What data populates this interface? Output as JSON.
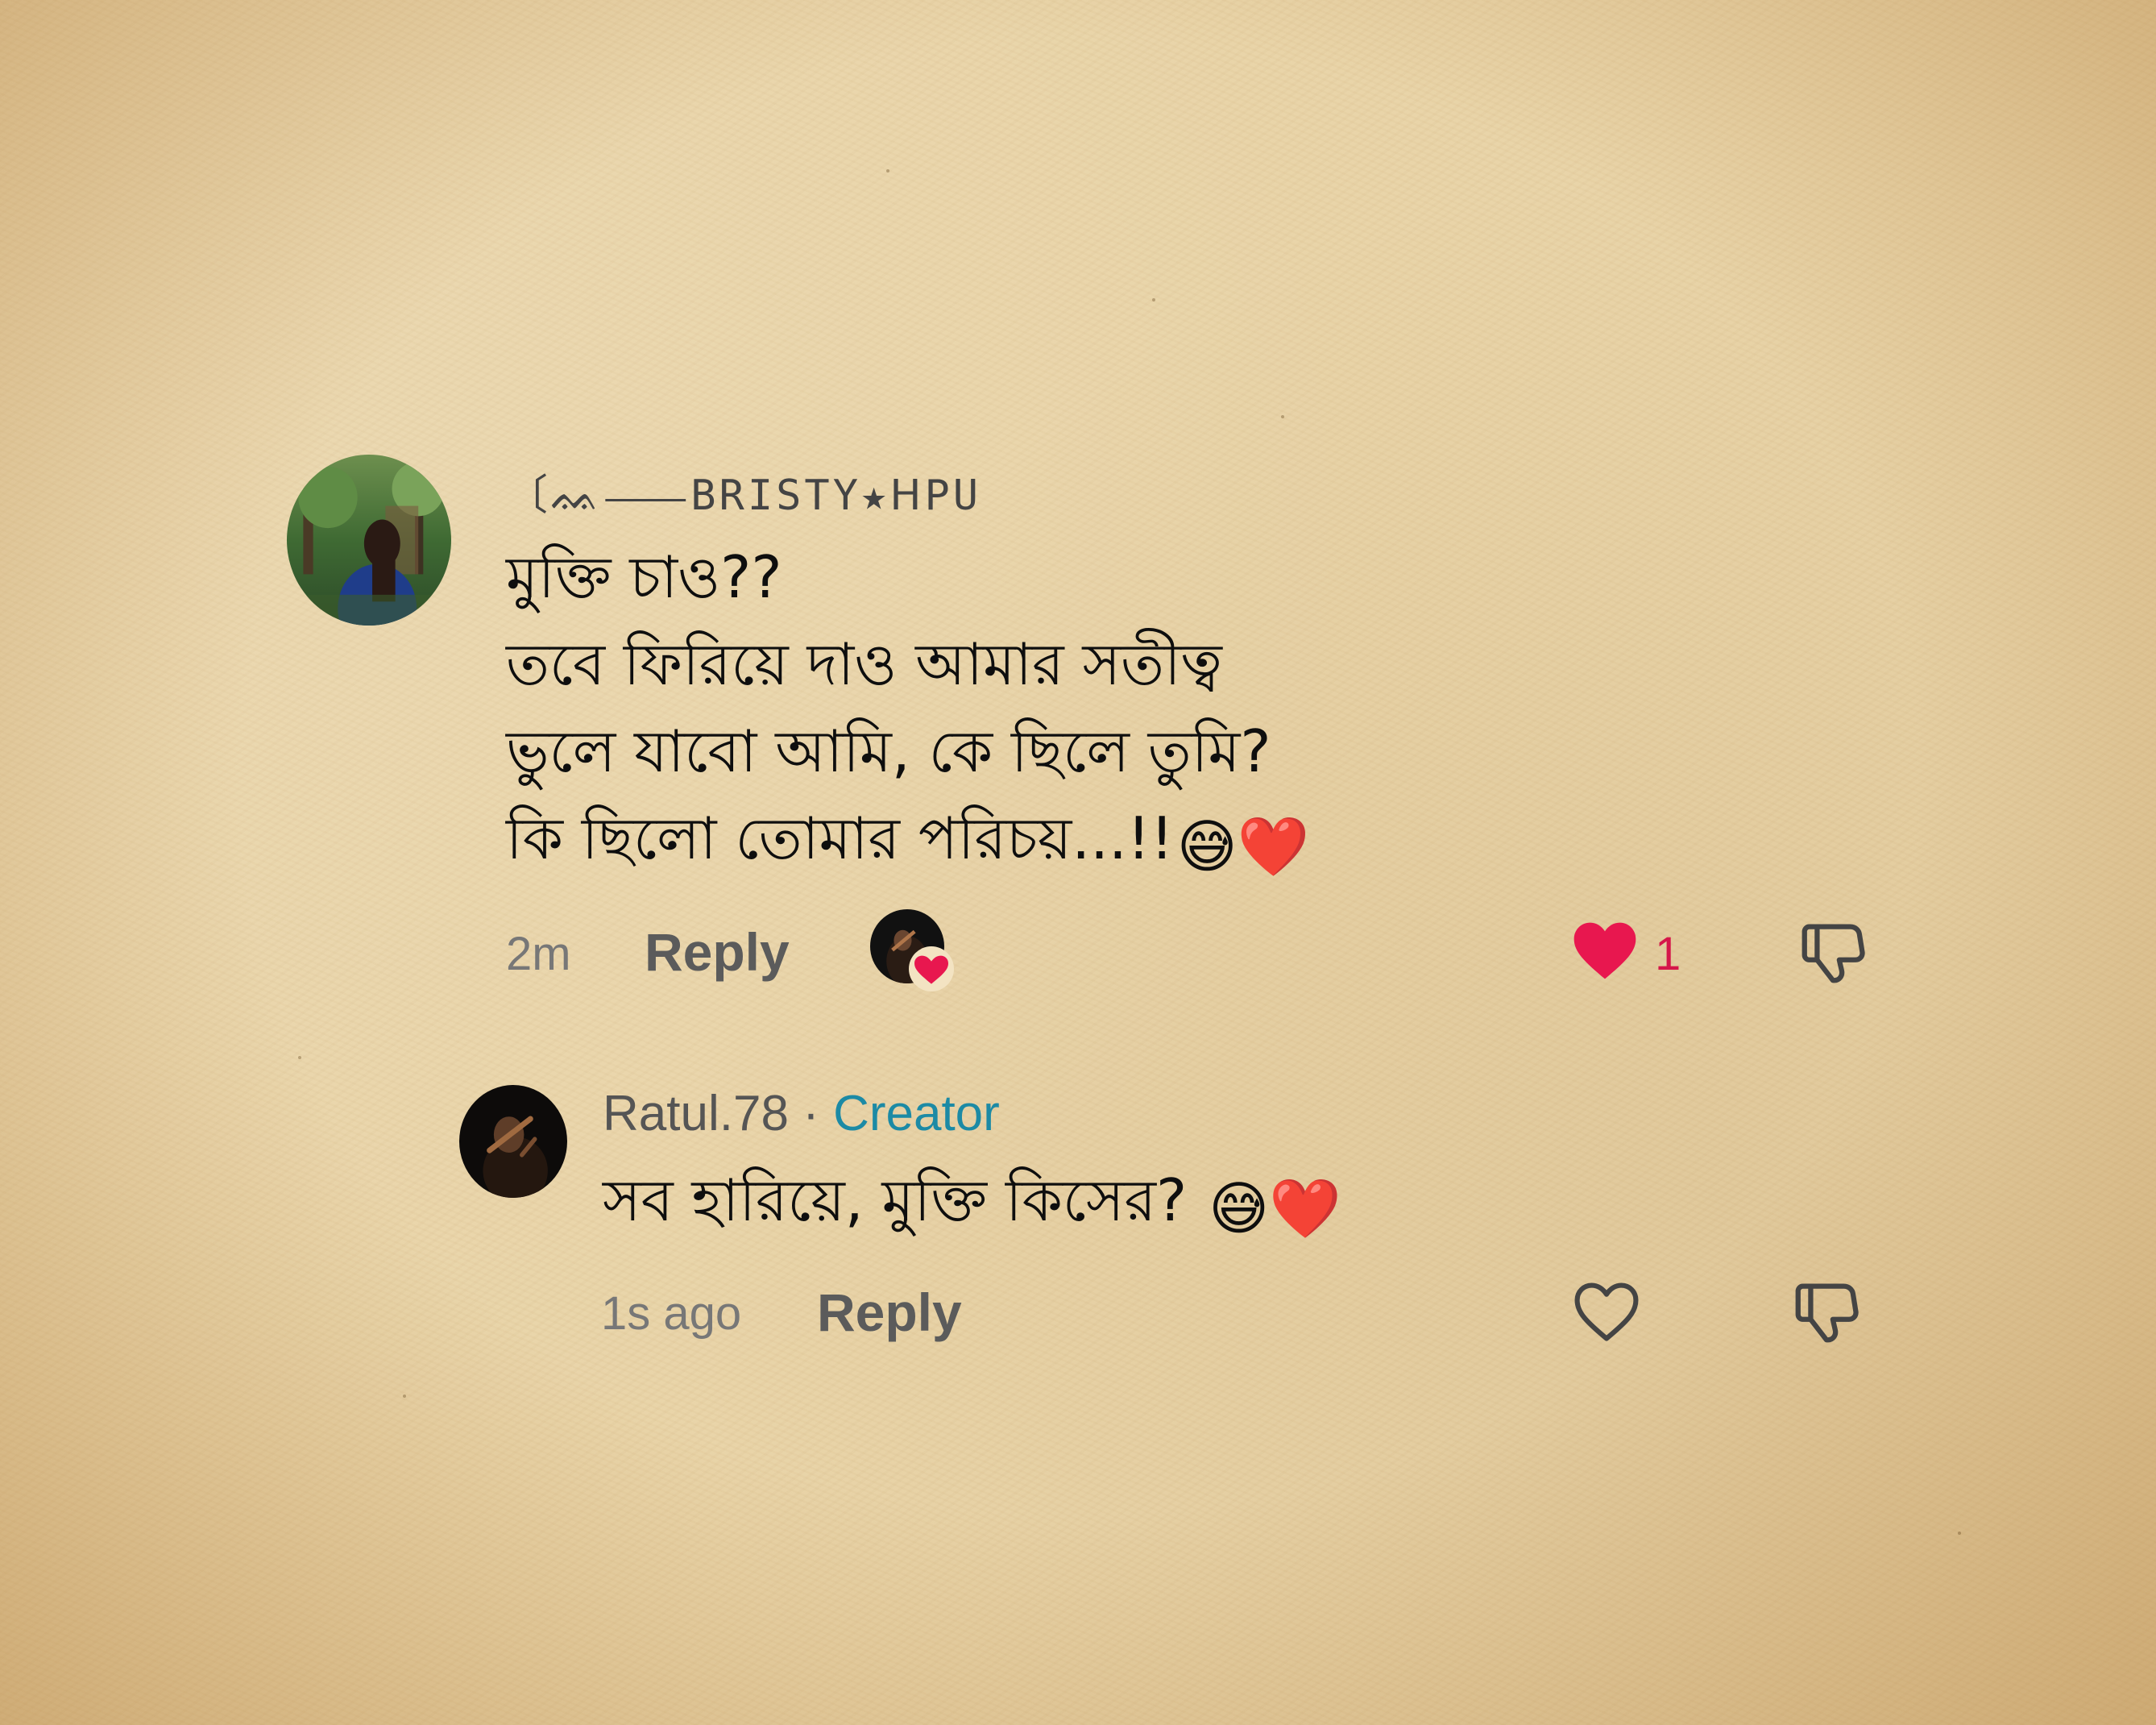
{
  "comment": {
    "username": "〔ᨐ⸺BRISTY★ᕼPU",
    "lines": [
      "মুক্তি চাও??",
      "তবে ফিরিয়ে দাও আমার সতীত্ব",
      "ভুলে যাবো আমি, কে ছিলে তুমি?",
      "কি ছিলো তোমার পরিচয়...!!"
    ],
    "emojis": "😅❤️",
    "time": "2m",
    "reply_label": "Reply",
    "like_count": "1",
    "liked_by_creator": true,
    "avatar_icon": "user-photo-avatar"
  },
  "reply": {
    "username": "Ratul.78",
    "separator": "·",
    "badge": "Creator",
    "text": "সব হারিয়ে, মুক্তি কিসের?",
    "emojis": "😅❤️",
    "time": "1s ago",
    "reply_label": "Reply",
    "avatar_icon": "creator-avatar"
  },
  "colors": {
    "like_red": "#e8174f",
    "creator_blue": "#1c8aa5",
    "paper": "#e9d3a6"
  },
  "icons": {
    "like_filled": "heart-filled-icon",
    "like_outline": "heart-outline-icon",
    "dislike": "thumbs-down-icon"
  }
}
